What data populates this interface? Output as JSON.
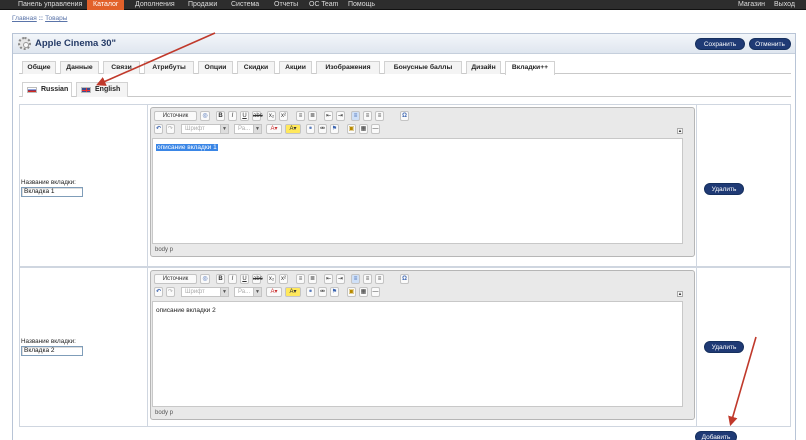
{
  "nav": {
    "items": [
      "Панель управления",
      "Каталог",
      "Дополнения",
      "Продажи",
      "Система",
      "Отчеты",
      "OC Team",
      "Помощь"
    ],
    "right": [
      "Магазин",
      "Выход"
    ]
  },
  "breadcrumb": {
    "home": "Главная",
    "sep": "::",
    "current": "Товары"
  },
  "product": {
    "title": "Apple Cinema 30\""
  },
  "buttons": {
    "save": "Сохранить",
    "cancel": "Отменить",
    "delete": "Удалить",
    "add": "Добавить"
  },
  "tabs": [
    "Общие",
    "Данные",
    "Связи",
    "Атрибуты",
    "Опции",
    "Скидки",
    "Акции",
    "Изображения",
    "Бонусные баллы",
    "Дизайн",
    "Вкладки++"
  ],
  "active_tab": "Вкладки++",
  "languages": [
    "Russian",
    "English"
  ],
  "editor": {
    "source_label": "Источник",
    "font_placeholder": "Шрифт",
    "size_placeholder": "Ра...",
    "path": "body  p"
  },
  "field_label": "Название вкладки:",
  "rows": [
    {
      "tab_name": "Вкладка 1",
      "content": "описание вкладки 1"
    },
    {
      "tab_name": "Вкладка 2",
      "content": "описание вкладки 2"
    }
  ],
  "colors": {
    "accent": "#e2612a",
    "button": "#1f3a75",
    "arrow": "#c0392b"
  }
}
